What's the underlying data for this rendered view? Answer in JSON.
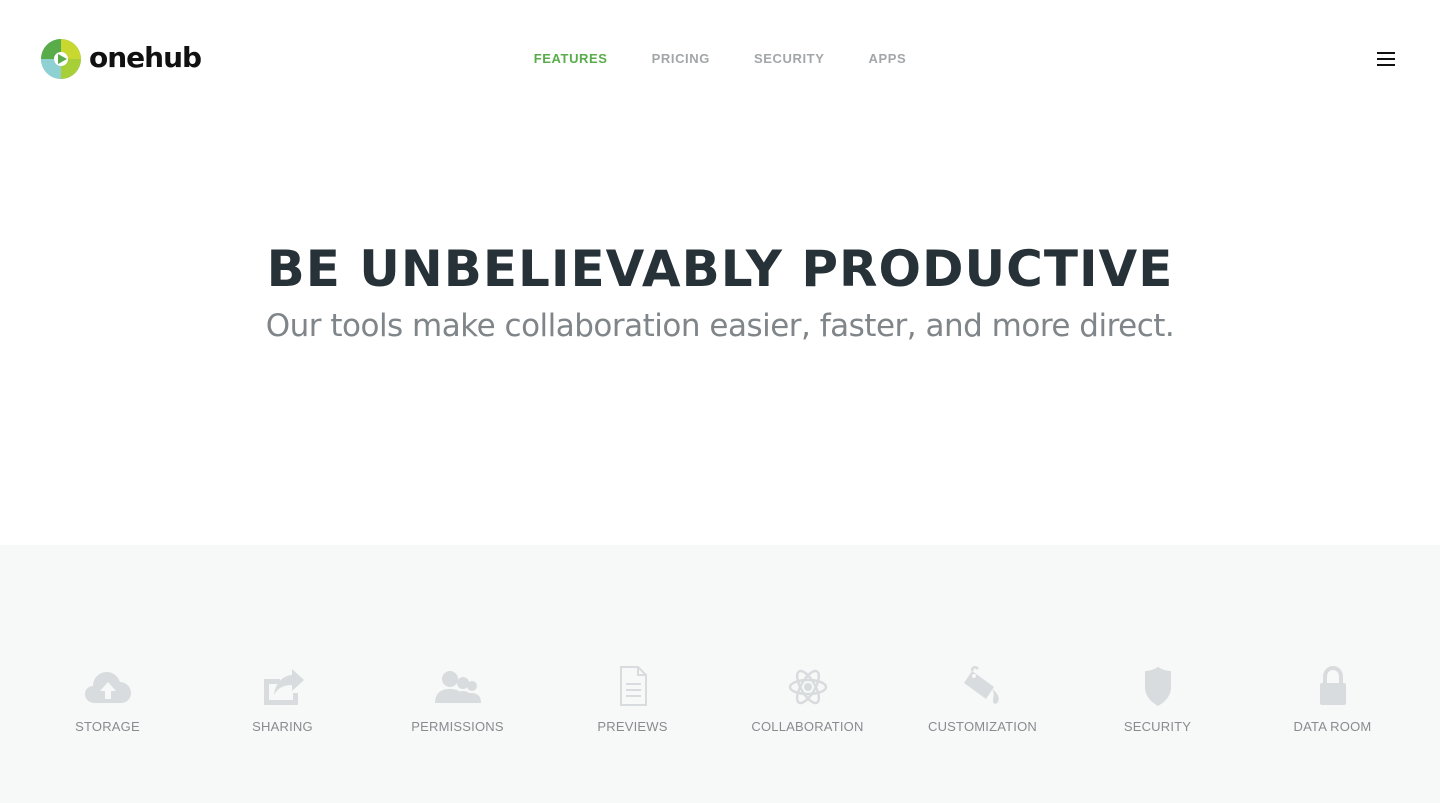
{
  "brand": {
    "name": "onehub",
    "colors": {
      "green": "#58ac49",
      "lime": "#c8d830",
      "teal": "#6cc3c6",
      "dark": "#111111"
    }
  },
  "nav": {
    "items": [
      {
        "label": "FEATURES",
        "active": true
      },
      {
        "label": "PRICING",
        "active": false
      },
      {
        "label": "SECURITY",
        "active": false
      },
      {
        "label": "APPS",
        "active": false
      }
    ],
    "active_color": "#58ac49",
    "inactive_color": "#a3a6a8",
    "menu_icon": "hamburger-icon"
  },
  "hero": {
    "title": "BE UNBELIEVABLY PRODUCTIVE",
    "subtitle": "Our tools make collaboration easier, faster, and more direct."
  },
  "features": {
    "background": "#f7f8f8",
    "icon_color": "#d9dcde",
    "items": [
      {
        "label": "STORAGE",
        "icon": "cloud-upload-icon"
      },
      {
        "label": "SHARING",
        "icon": "share-icon"
      },
      {
        "label": "PERMISSIONS",
        "icon": "users-icon"
      },
      {
        "label": "PREVIEWS",
        "icon": "document-icon"
      },
      {
        "label": "COLLABORATION",
        "icon": "atom-icon"
      },
      {
        "label": "CUSTOMIZATION",
        "icon": "paint-bucket-icon"
      },
      {
        "label": "SECURITY",
        "icon": "shield-icon"
      },
      {
        "label": "DATA ROOM",
        "icon": "lock-icon"
      }
    ]
  }
}
